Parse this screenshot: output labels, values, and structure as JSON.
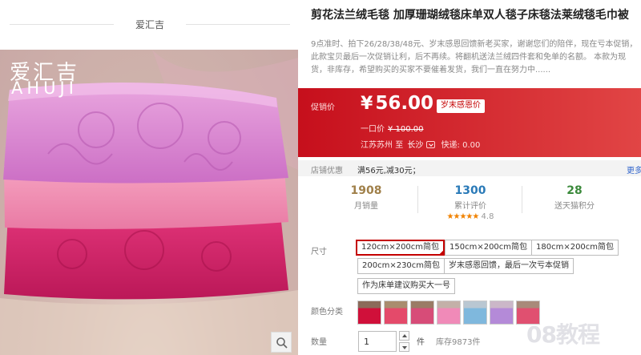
{
  "shop": {
    "name": "爱汇吉"
  },
  "brand": {
    "cn": "爱汇吉",
    "en": "AHUJI"
  },
  "product": {
    "title": "剪花法兰绒毛毯 加厚珊瑚绒毯床单双人毯子床毯法莱绒毯毛巾被",
    "desc": "9点准时、拍下26/28/38/48元、岁末感恩回馈新老买家，谢谢您们的陪伴，现在亏本促销，此款宝贝最后一次促销让利，后不再续。将翻机送法兰绒四件套和免单的名额。 本款为现货，非库存，希望购买的买家不要催着发货，我们一直在努力中......"
  },
  "price": {
    "label": "促销价",
    "currency": "¥",
    "value": "56.00",
    "promo_tag": "岁末感恩价",
    "orig_label": "一口价",
    "orig_value": "¥ 100.00",
    "ship_from": "江苏苏州",
    "ship_to_label": "至",
    "ship_to": "长沙",
    "shipping_fee": "快递: 0.00"
  },
  "coupon": {
    "label": "店铺优惠",
    "text": "满56元,减30元；",
    "more": "更多"
  },
  "stats": [
    {
      "num": "1908",
      "cap": "月销量",
      "color": "#a0804a"
    },
    {
      "num": "1300",
      "cap": "累计评价",
      "color": "#2a7ab8",
      "stars": "★★★★★",
      "rating": "4.8"
    },
    {
      "num": "28",
      "cap": "送天猫积分",
      "color": "#3c8a3c"
    }
  ],
  "options": {
    "label": "尺寸",
    "items": [
      "120cm×200cm简包",
      "150cm×200cm简包",
      "180cm×200cm简包",
      "200cm×230cm简包",
      "岁末感恩回馈，最后一次亏本促销",
      "作为床单建议购买大一号"
    ],
    "selected": 0
  },
  "colors": {
    "label": "颜色分类",
    "swatches": [
      {
        "name": "swatch-1",
        "main": "#d0103a",
        "top": "#8b6a5a"
      },
      {
        "name": "swatch-2",
        "main": "#e44a6a",
        "top": "#a98c6e"
      },
      {
        "name": "swatch-3",
        "main": "#d74c78",
        "top": "#9a7b66"
      },
      {
        "name": "swatch-4",
        "main": "#f08ab8",
        "top": "#c3b0a8"
      },
      {
        "name": "swatch-5",
        "main": "#7fb8dd",
        "top": "#b9c7d2"
      },
      {
        "name": "swatch-6",
        "main": "#b48ad8",
        "top": "#cbb7c8"
      },
      {
        "name": "swatch-7",
        "main": "#e05070",
        "top": "#a88a7a"
      }
    ]
  },
  "quantity": {
    "label": "数量",
    "value": "1",
    "unit": "件",
    "stock": "库存9873件"
  },
  "watermark": "08教程",
  "icons": {
    "zoom": "search-icon"
  }
}
